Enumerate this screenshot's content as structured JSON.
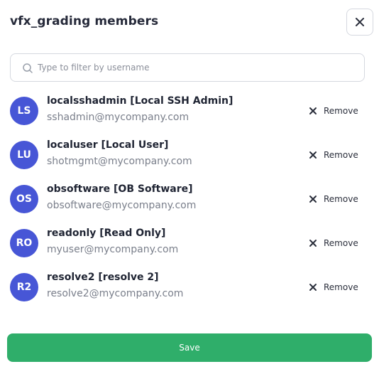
{
  "dialog": {
    "title": "vfx_grading members",
    "close_icon": "close-icon"
  },
  "filter": {
    "placeholder": "Type to filter by username",
    "value": "",
    "icon": "search-icon"
  },
  "members": [
    {
      "initials": "LS",
      "name": "localsshadmin [Local SSH Admin]",
      "email": "sshadmin@mycompany.com",
      "remove_label": "Remove"
    },
    {
      "initials": "LU",
      "name": "localuser [Local User]",
      "email": "shotmgmt@mycompany.com",
      "remove_label": "Remove"
    },
    {
      "initials": "OS",
      "name": "obsoftware [OB Software]",
      "email": "obsoftware@mycompany.com",
      "remove_label": "Remove"
    },
    {
      "initials": "RO",
      "name": "readonly [Read Only]",
      "email": "myuser@mycompany.com",
      "remove_label": "Remove"
    },
    {
      "initials": "R2",
      "name": "resolve2 [resolve 2]",
      "email": "resolve2@mycompany.com",
      "remove_label": "Remove"
    }
  ],
  "footer": {
    "save_label": "Save"
  },
  "colors": {
    "avatar_bg": "#4756d6",
    "save_bg": "#2fae6a",
    "border": "#d5d8df"
  }
}
